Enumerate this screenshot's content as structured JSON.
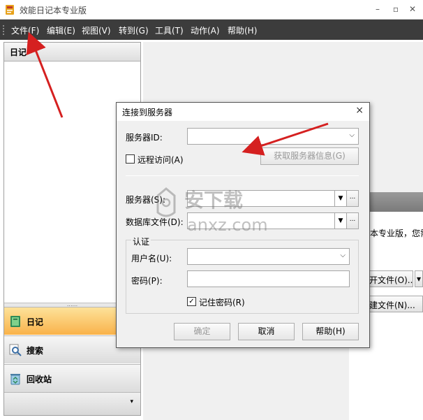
{
  "window": {
    "title": "效能日记本专业版"
  },
  "menu": [
    "文件(F)",
    "编辑(E)",
    "视图(V)",
    "转到(G)",
    "工具(T)",
    "动作(A)",
    "帮助(H)"
  ],
  "left_panel": {
    "header": "日记",
    "nav": [
      {
        "label": "日记",
        "icon": "diary-icon",
        "active": true
      },
      {
        "label": "搜索",
        "icon": "search-icon",
        "active": false
      },
      {
        "label": "回收站",
        "icon": "recycle-bin-icon",
        "active": false
      }
    ],
    "footer_glyph": "▾"
  },
  "background": {
    "text": "本专业版，您需",
    "btn1": "开文件(O)...",
    "btn2": "建文件(N)..."
  },
  "dialog": {
    "title": "连接到服务器",
    "server_id_label": "服务器ID:",
    "server_id_value": "",
    "remote_access_label": "远程访问(A)",
    "remote_access_checked": false,
    "get_server_info_button": "获取服务器信息(G)",
    "server_label": "服务器(S):",
    "server_value": "",
    "db_file_label": "数据库文件(D):",
    "db_file_value": "",
    "auth_group": "认证",
    "username_label": "用户名(U):",
    "username_value": "",
    "password_label": "密码(P):",
    "password_value": "",
    "remember_password_label": "记住密码(R)",
    "remember_password_checked": true,
    "ok_button": "确定",
    "cancel_button": "取消",
    "help_button": "帮助(H)"
  },
  "watermark": {
    "text_cn": "安下载",
    "text_en": "anxz.com"
  }
}
